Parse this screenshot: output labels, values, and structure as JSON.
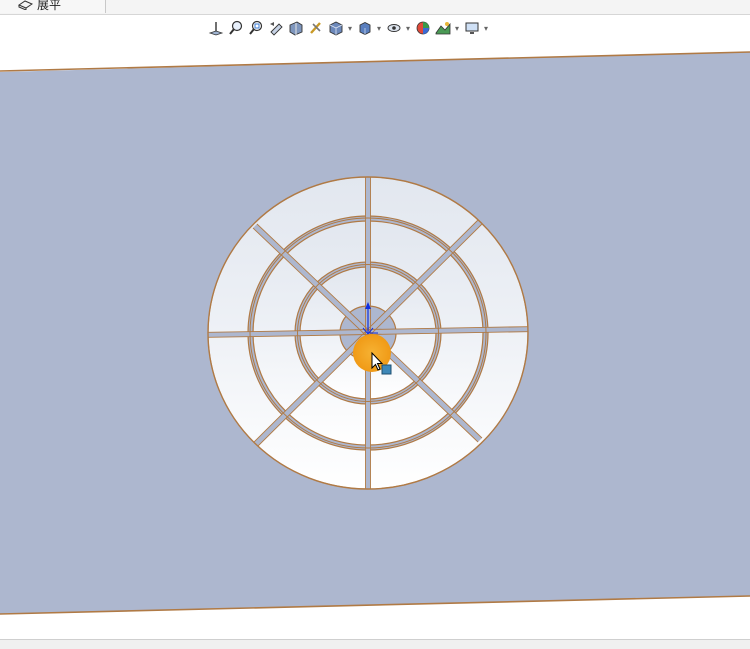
{
  "panel": {
    "unfold_label": "展平",
    "unfold_icon": "sheet-metal-flatten-icon"
  },
  "heads_up_toolbar": {
    "icons": [
      "view-normal-icon",
      "zoom-to-fit-icon",
      "zoom-to-area-icon",
      "previous-view-icon",
      "section-view-icon",
      "dynamic-annotation-icon",
      "view-orientation-icon",
      "display-style-icon",
      "hide-show-items-icon",
      "edit-appearance-icon",
      "apply-scene-icon",
      "view-settings-icon"
    ]
  },
  "colors": {
    "viewport_background": "#adb7cf",
    "part_face": "#e9edf3",
    "edge": "#b07a45",
    "triad_y": "#1030e0",
    "selection_highlight": "#f2a11f",
    "cursor_badge": "#3e88b8"
  }
}
